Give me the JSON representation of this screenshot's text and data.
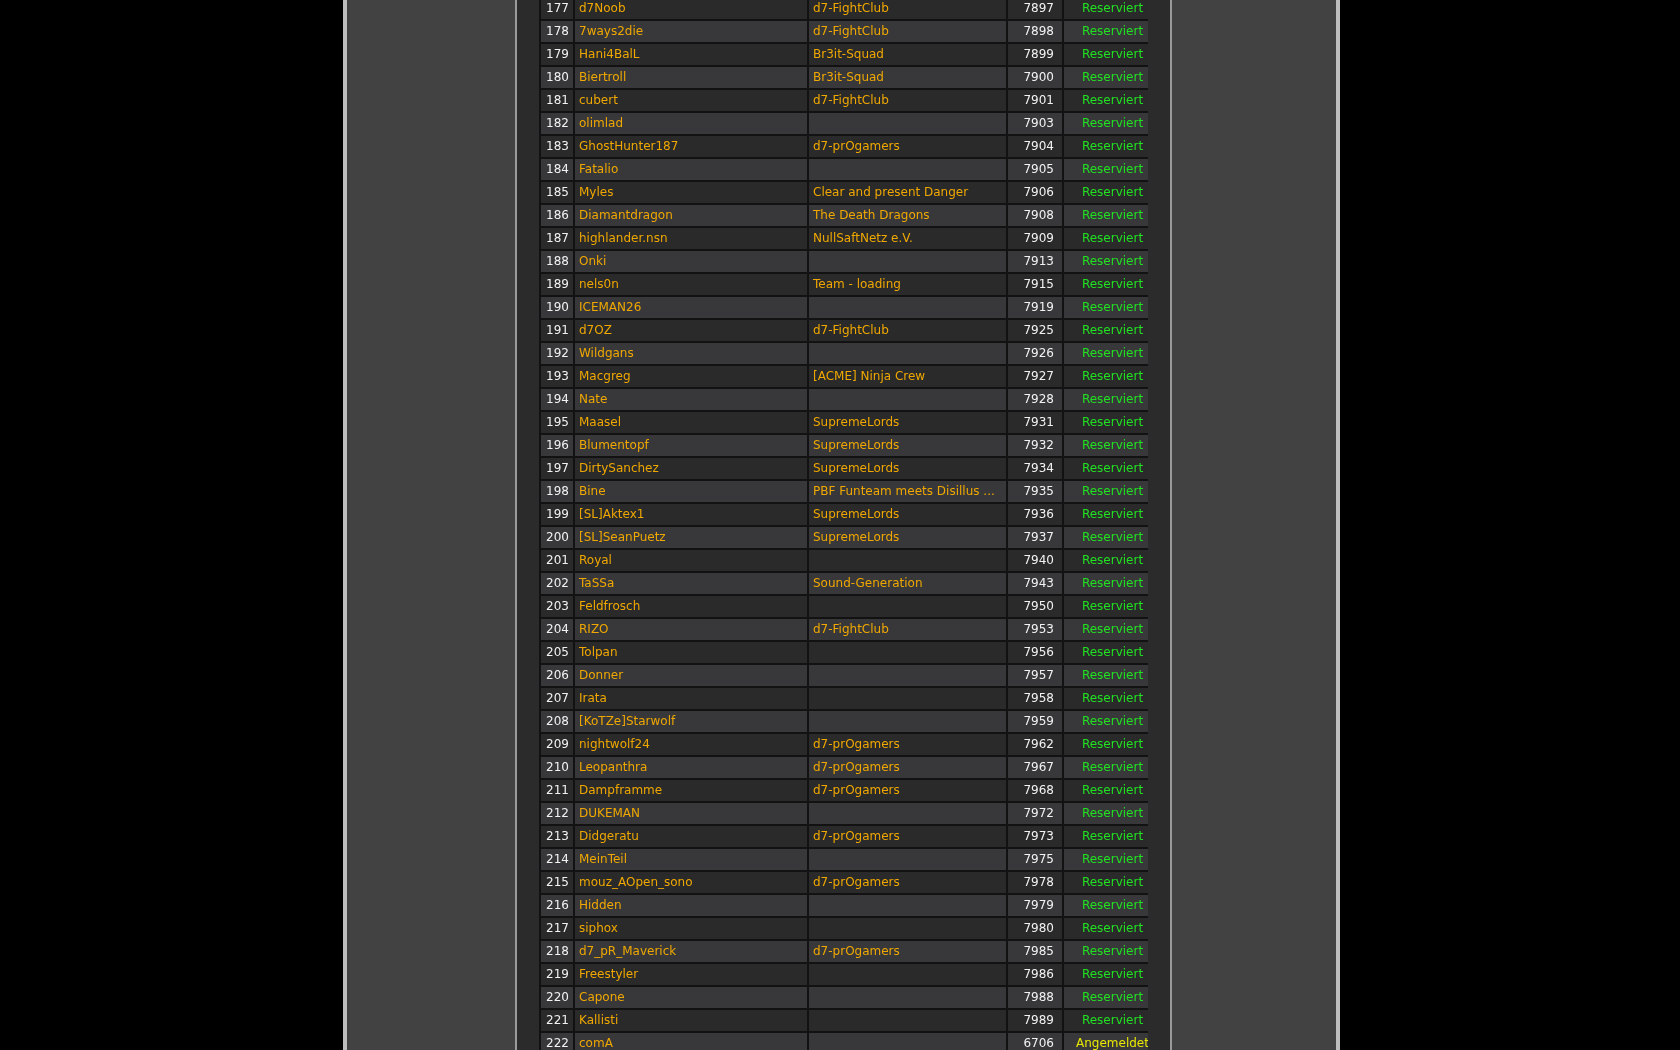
{
  "table": {
    "rows": [
      {
        "column_1": "177",
        "column_2": "d7Noob",
        "column_3": "d7-FightClub",
        "column_4": "7897",
        "column_5": "Reserviert",
        "kind": "reserved"
      },
      {
        "column_1": "178",
        "column_2": "7ways2die",
        "column_3": "d7-FightClub",
        "column_4": "7898",
        "column_5": "Reserviert",
        "kind": "reserved"
      },
      {
        "column_1": "179",
        "column_2": "Hani4BalL",
        "column_3": "Br3it-Squad",
        "column_4": "7899",
        "column_5": "Reserviert",
        "kind": "reserved"
      },
      {
        "column_1": "180",
        "column_2": "Biertroll",
        "column_3": "Br3it-Squad",
        "column_4": "7900",
        "column_5": "Reserviert",
        "kind": "reserved"
      },
      {
        "column_1": "181",
        "column_2": "cubert",
        "column_3": "d7-FightClub",
        "column_4": "7901",
        "column_5": "Reserviert",
        "kind": "reserved"
      },
      {
        "column_1": "182",
        "column_2": "olimlad",
        "column_4": "7903",
        "column_5": "Reserviert",
        "kind": "reserved"
      },
      {
        "column_1": "183",
        "column_2": "GhostHunter187",
        "column_3": "d7-prOgamers",
        "column_4": "7904",
        "column_5": "Reserviert",
        "kind": "reserved"
      },
      {
        "column_1": "184",
        "column_2": "Fatalio",
        "column_4": "7905",
        "column_5": "Reserviert",
        "kind": "reserved"
      },
      {
        "column_1": "185",
        "column_2": "Myles",
        "column_3": "Clear and present Danger",
        "column_4": "7906",
        "column_5": "Reserviert",
        "kind": "reserved"
      },
      {
        "column_1": "186",
        "column_2": "Diamantdragon",
        "column_3": "The Death Dragons",
        "column_4": "7908",
        "column_5": "Reserviert",
        "kind": "reserved"
      },
      {
        "column_1": "187",
        "column_2": "highlander.nsn",
        "column_3": "NullSaftNetz e.V.",
        "column_4": "7909",
        "column_5": "Reserviert",
        "kind": "reserved"
      },
      {
        "column_1": "188",
        "column_2": "Onki",
        "column_4": "7913",
        "column_5": "Reserviert",
        "kind": "reserved"
      },
      {
        "column_1": "189",
        "column_2": "nels0n",
        "column_3": "Team - loading",
        "column_4": "7915",
        "column_5": "Reserviert",
        "kind": "reserved"
      },
      {
        "column_1": "190",
        "column_2": "ICEMAN26",
        "column_4": "7919",
        "column_5": "Reserviert",
        "kind": "reserved"
      },
      {
        "column_1": "191",
        "column_2": "d7OZ",
        "column_3": "d7-FightClub",
        "column_4": "7925",
        "column_5": "Reserviert",
        "kind": "reserved"
      },
      {
        "column_1": "192",
        "column_2": "Wildgans",
        "column_4": "7926",
        "column_5": "Reserviert",
        "kind": "reserved"
      },
      {
        "column_1": "193",
        "column_2": "Macgreg",
        "column_3": "[ACME] Ninja Crew",
        "column_4": "7927",
        "column_5": "Reserviert",
        "kind": "reserved"
      },
      {
        "column_1": "194",
        "column_2": "Nate",
        "column_4": "7928",
        "column_5": "Reserviert",
        "kind": "reserved"
      },
      {
        "column_1": "195",
        "column_2": "Maasel",
        "column_3": "SupremeLords",
        "column_4": "7931",
        "column_5": "Reserviert",
        "kind": "reserved"
      },
      {
        "column_1": "196",
        "column_2": "Blumentopf",
        "column_3": "SupremeLords",
        "column_4": "7932",
        "column_5": "Reserviert",
        "kind": "reserved"
      },
      {
        "column_1": "197",
        "column_2": "DirtySanchez",
        "column_3": "SupremeLords",
        "column_4": "7934",
        "column_5": "Reserviert",
        "kind": "reserved"
      },
      {
        "column_1": "198",
        "column_2": "Bine",
        "column_3": "PBF Funteam meets Disillus ...",
        "column_4": "7935",
        "column_5": "Reserviert",
        "kind": "reserved"
      },
      {
        "column_1": "199",
        "column_2": "[SL]Aktex1",
        "column_3": "SupremeLords",
        "column_4": "7936",
        "column_5": "Reserviert",
        "kind": "reserved"
      },
      {
        "column_1": "200",
        "column_2": "[SL]SeanPuetz",
        "column_3": "SupremeLords",
        "column_4": "7937",
        "column_5": "Reserviert",
        "kind": "reserved"
      },
      {
        "column_1": "201",
        "column_2": "Royal",
        "column_4": "7940",
        "column_5": "Reserviert",
        "kind": "reserved"
      },
      {
        "column_1": "202",
        "column_2": "TaSSa",
        "column_3": "Sound-Generation",
        "column_4": "7943",
        "column_5": "Reserviert",
        "kind": "reserved"
      },
      {
        "column_1": "203",
        "column_2": "Feldfrosch",
        "column_4": "7950",
        "column_5": "Reserviert",
        "kind": "reserved"
      },
      {
        "column_1": "204",
        "column_2": "RIZO",
        "column_3": "d7-FightClub",
        "column_4": "7953",
        "column_5": "Reserviert",
        "kind": "reserved"
      },
      {
        "column_1": "205",
        "column_2": "Tolpan",
        "column_4": "7956",
        "column_5": "Reserviert",
        "kind": "reserved"
      },
      {
        "column_1": "206",
        "column_2": "Donner",
        "column_4": "7957",
        "column_5": "Reserviert",
        "kind": "reserved"
      },
      {
        "column_1": "207",
        "column_2": "Irata",
        "column_4": "7958",
        "column_5": "Reserviert",
        "kind": "reserved"
      },
      {
        "column_1": "208",
        "column_2": "[KoTZe]Starwolf",
        "column_4": "7959",
        "column_5": "Reserviert",
        "kind": "reserved"
      },
      {
        "column_1": "209",
        "column_2": "nightwolf24",
        "column_3": "d7-prOgamers",
        "column_4": "7962",
        "column_5": "Reserviert",
        "kind": "reserved"
      },
      {
        "column_1": "210",
        "column_2": "Leopanthra",
        "column_3": "d7-prOgamers",
        "column_4": "7967",
        "column_5": "Reserviert",
        "kind": "reserved"
      },
      {
        "column_1": "211",
        "column_2": "Dampframme",
        "column_3": "d7-prOgamers",
        "column_4": "7968",
        "column_5": "Reserviert",
        "kind": "reserved"
      },
      {
        "column_1": "212",
        "column_2": "DUKEMAN",
        "column_4": "7972",
        "column_5": "Reserviert",
        "kind": "reserved"
      },
      {
        "column_1": "213",
        "column_2": "Didgeratu",
        "column_3": "d7-prOgamers",
        "column_4": "7973",
        "column_5": "Reserviert",
        "kind": "reserved"
      },
      {
        "column_1": "214",
        "column_2": "MeinTeil",
        "column_4": "7975",
        "column_5": "Reserviert",
        "kind": "reserved"
      },
      {
        "column_1": "215",
        "column_2": "mouz_AOpen_sono",
        "column_3": "d7-prOgamers",
        "column_4": "7978",
        "column_5": "Reserviert",
        "kind": "reserved"
      },
      {
        "column_1": "216",
        "column_2": "Hidden",
        "column_4": "7979",
        "column_5": "Reserviert",
        "kind": "reserved"
      },
      {
        "column_1": "217",
        "column_2": "siphox",
        "column_4": "7980",
        "column_5": "Reserviert",
        "kind": "reserved"
      },
      {
        "column_1": "218",
        "column_2": "d7_pR_Maverick",
        "column_3": "d7-prOgamers",
        "column_4": "7985",
        "column_5": "Reserviert",
        "kind": "reserved"
      },
      {
        "column_1": "219",
        "column_2": "Freestyler",
        "column_4": "7986",
        "column_5": "Reserviert",
        "kind": "reserved"
      },
      {
        "column_1": "220",
        "column_2": "Capone",
        "column_4": "7988",
        "column_5": "Reserviert",
        "kind": "reserved"
      },
      {
        "column_1": "221",
        "column_2": "Kallisti",
        "column_4": "7989",
        "column_5": "Reserviert",
        "kind": "reserved"
      },
      {
        "column_1": "222",
        "column_2": "comA",
        "column_4": "6706",
        "column_5": "Angemeldet",
        "kind": "registered"
      }
    ]
  }
}
